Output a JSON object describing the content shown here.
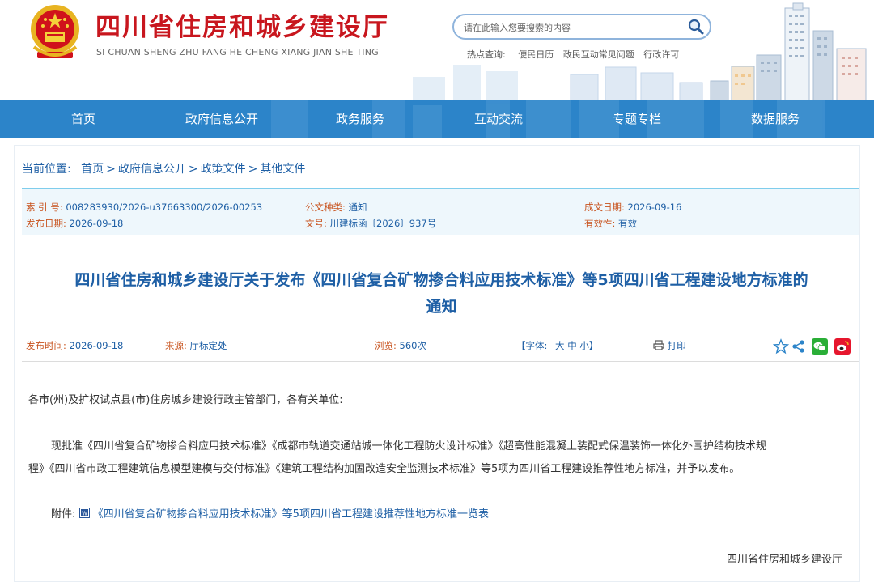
{
  "header": {
    "site_title": "四川省住房和城乡建设厅",
    "site_pinyin": "SI CHUAN SHENG ZHU FANG HE CHENG XIANG JIAN SHE TING",
    "search_placeholder": "请在此输入您要搜索的内容",
    "hot_label": "热点查询:",
    "hot_links": [
      "便民日历",
      "政民互动常见问题",
      "行政许可"
    ]
  },
  "nav": {
    "items": [
      "首页",
      "政府信息公开",
      "政务服务",
      "互动交流",
      "专题专栏",
      "数据服务"
    ]
  },
  "breadcrumb": {
    "label": "当前位置:",
    "items": [
      "首页",
      "政府信息公开",
      "政策文件",
      "其他文件"
    ],
    "sep": ">"
  },
  "meta": {
    "index_label": "索 引 号:",
    "index_value": "008283930/2026-u37663300/2026-00253",
    "type_label": "公文种类:",
    "type_value": "通知",
    "created_label": "成文日期:",
    "created_value": "2026-09-16",
    "publish_label": "发布日期:",
    "publish_value": "2026-09-18",
    "docno_label": "文号:",
    "docno_value": "川建标函〔2026〕937号",
    "valid_label": "有效性:",
    "valid_value": "有效"
  },
  "doc": {
    "title_line1": "四川省住房和城乡建设厅关于发布《四川省复合矿物掺合料应用技术标准》等5项四川省工程建设地方标准的",
    "title_line2": "通知"
  },
  "info": {
    "time_label": "发布时间:",
    "time_value": "2026-09-18",
    "source_label": "来源:",
    "source_value": "厅标定处",
    "views_label": "浏览:",
    "views_value": "560次",
    "font_open": "【字体:",
    "font_large": "大",
    "font_medium": "中",
    "font_small": "小",
    "font_close": "】",
    "print_label": "打印"
  },
  "content": {
    "salutation": "各市(州)及扩权试点县(市)住房城乡建设行政主管部门，各有关单位:",
    "para1_line1": "现批准《四川省复合矿物掺合料应用技术标准》《成都市轨道交通站城一体化工程防火设计标准》《超高性能混凝土装配式保温装饰一体化外围护结构技术规",
    "para1_line2": "程》《四川省市政工程建筑信息模型建模与交付标准》《建筑工程结构加固改造安全监测技术标准》等5项为四川省工程建设推荐性地方标准，并予以发布。",
    "attach_label": "附件:",
    "attach_link": "《四川省复合矿物掺合料应用技术标准》等5项四川省工程建设推荐性地方标准一览表",
    "signature": "四川省住房和城乡建设厅"
  },
  "colors": {
    "brand_red": "#c8161e",
    "nav_blue": "#2c84c9",
    "link_blue": "#1e5fa5",
    "label_orange": "#c8531e"
  },
  "icons": [
    "national-emblem-icon",
    "search-icon",
    "print-icon",
    "favorite-star-icon",
    "share-icon",
    "wechat-icon",
    "weibo-icon",
    "word-doc-icon"
  ]
}
